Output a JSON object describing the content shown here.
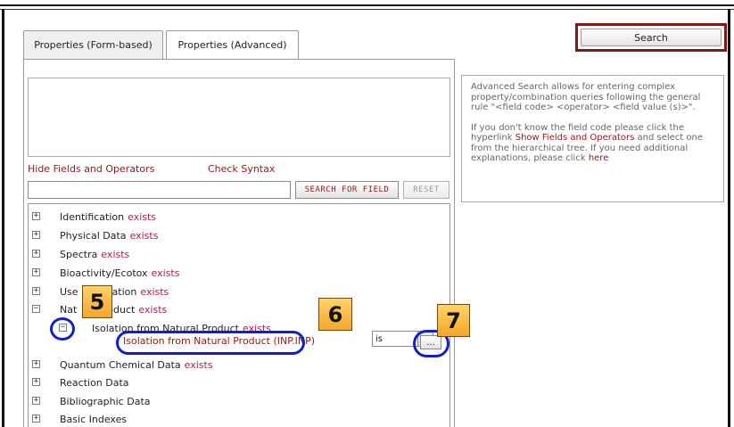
{
  "tabs": [
    {
      "label": "Properties (Form-based)",
      "active": false
    },
    {
      "label": "Properties (Advanced)",
      "active": true
    }
  ],
  "search_button": {
    "label": "Search"
  },
  "query_editor": {
    "value": "",
    "placeholder": ""
  },
  "links": {
    "hide_fields": "Hide Fields and Operators",
    "check_syntax": "Check Syntax"
  },
  "field_search": {
    "value": "",
    "search_button": "SEARCH FOR FIELD",
    "reset_button": "RESET"
  },
  "tree": {
    "items": [
      {
        "label": "Identification",
        "status": "exists",
        "expanded": false
      },
      {
        "label": "Physical Data",
        "status": "exists",
        "expanded": false
      },
      {
        "label": "Spectra",
        "status": "exists",
        "expanded": false
      },
      {
        "label": "Bioactivity/Ecotox",
        "status": "exists",
        "expanded": false
      },
      {
        "label": "Use",
        "label_tail": "ation",
        "status": "exists",
        "expanded": false
      },
      {
        "label": "Nat",
        "label_tail": "oduct",
        "status": "exists",
        "expanded": true
      },
      {
        "label": "Isolation from Natural Product",
        "status": "exists",
        "expanded": true
      },
      {
        "label": "Quantum Chemical Data",
        "status": "exists",
        "expanded": false
      },
      {
        "label": "Reaction Data",
        "status": "",
        "expanded": false
      },
      {
        "label": "Bibliographic Data",
        "status": "",
        "expanded": false
      },
      {
        "label": "Basic Indexes",
        "status": "",
        "expanded": false
      }
    ],
    "field_row": {
      "field": "Isolation from Natural Product (INP.INP)",
      "operator": "is",
      "value_button": "..."
    }
  },
  "callouts": {
    "c5": "5",
    "c6": "6",
    "c7": "7"
  },
  "help": {
    "para1": "Advanced Search allows for entering complex property/combination queries following the general rule \"<field code> <operator> <field value (s)>\".",
    "para2_a": "If you don't know the field code please click the hyperlink ",
    "para2_link1": "Show Fields and Operators",
    "para2_b": " and select one from the hierarchical tree. If you need additional explanations, please click ",
    "para2_link2": "here"
  },
  "colors": {
    "accent_red": "#8b1a1a",
    "exists": "#a8224a",
    "highlight_ring": "#1020c8",
    "callout": "#f4a62a"
  }
}
